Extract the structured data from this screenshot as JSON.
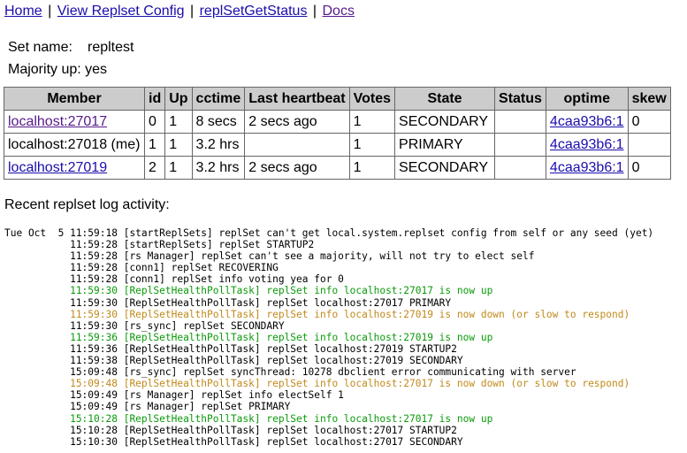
{
  "nav": {
    "home": "Home",
    "view_config": "View Replset Config",
    "get_status": "replSetGetStatus",
    "docs": "Docs",
    "sep": "|"
  },
  "info": {
    "set_name_label": "Set name:",
    "set_name_value": "repltest",
    "majority_label": "Majority up:",
    "majority_value": "yes"
  },
  "table": {
    "headers": [
      "Member",
      "id",
      "Up",
      "cctime",
      "Last heartbeat",
      "Votes",
      "State",
      "Status",
      "optime",
      "skew"
    ],
    "rows": [
      {
        "member": "localhost:27017",
        "member_link": true,
        "id": "0",
        "up": "1",
        "cctime": "8 secs",
        "heartbeat": "2 secs ago",
        "votes": "1",
        "state": "SECONDARY",
        "status": "",
        "optime": "4caa93b6:1",
        "skew": "0"
      },
      {
        "member": "localhost:27018 (me)",
        "member_link": false,
        "id": "1",
        "up": "1",
        "cctime": "3.2 hrs",
        "heartbeat": "",
        "votes": "1",
        "state": "PRIMARY",
        "status": "",
        "optime": "4caa93b6:1",
        "skew": ""
      },
      {
        "member": "localhost:27019",
        "member_link": true,
        "id": "2",
        "up": "1",
        "cctime": "3.2 hrs",
        "heartbeat": "2 secs ago",
        "votes": "1",
        "state": "SECONDARY",
        "status": "",
        "optime": "4caa93b6:1",
        "skew": "0"
      }
    ]
  },
  "log_title": "Recent replset log activity:",
  "colors": {
    "link": "#1a0dab",
    "visited": "#551a8b",
    "log_green": "#0a9a0a",
    "log_orange": "#c08a1a",
    "header_bg": "#cccccc"
  },
  "log_lines": [
    {
      "text": "Tue Oct  5 11:59:18 [startReplSets] replSet can't get local.system.replset config from self or any seed (yet)",
      "color": ""
    },
    {
      "text": "           11:59:28 [startReplSets] replSet STARTUP2",
      "color": ""
    },
    {
      "text": "           11:59:28 [rs Manager] replSet can't see a majority, will not try to elect self",
      "color": ""
    },
    {
      "text": "           11:59:28 [conn1] replSet RECOVERING",
      "color": ""
    },
    {
      "text": "           11:59:28 [conn1] replSet info voting yea for 0",
      "color": ""
    },
    {
      "text": "           11:59:30 [ReplSetHealthPollTask] replSet info localhost:27017 is now up",
      "color": "green"
    },
    {
      "text": "           11:59:30 [ReplSetHealthPollTask] replSet localhost:27017 PRIMARY",
      "color": ""
    },
    {
      "text": "           11:59:30 [ReplSetHealthPollTask] replSet info localhost:27019 is now down (or slow to respond)",
      "color": "orange"
    },
    {
      "text": "           11:59:30 [rs_sync] replSet SECONDARY",
      "color": ""
    },
    {
      "text": "           11:59:36 [ReplSetHealthPollTask] replSet info localhost:27019 is now up",
      "color": "green"
    },
    {
      "text": "           11:59:36 [ReplSetHealthPollTask] replSet localhost:27019 STARTUP2",
      "color": ""
    },
    {
      "text": "           11:59:38 [ReplSetHealthPollTask] replSet localhost:27019 SECONDARY",
      "color": ""
    },
    {
      "text": "           15:09:48 [rs_sync] replSet syncThread: 10278 dbclient error communicating with server",
      "color": ""
    },
    {
      "text": "           15:09:48 [ReplSetHealthPollTask] replSet info localhost:27017 is now down (or slow to respond)",
      "color": "orange"
    },
    {
      "text": "           15:09:49 [rs Manager] replSet info electSelf 1",
      "color": ""
    },
    {
      "text": "           15:09:49 [rs Manager] replSet PRIMARY",
      "color": ""
    },
    {
      "text": "           15:10:28 [ReplSetHealthPollTask] replSet info localhost:27017 is now up",
      "color": "green"
    },
    {
      "text": "           15:10:28 [ReplSetHealthPollTask] replSet localhost:27017 STARTUP2",
      "color": ""
    },
    {
      "text": "           15:10:30 [ReplSetHealthPollTask] replSet localhost:27017 SECONDARY",
      "color": ""
    }
  ]
}
